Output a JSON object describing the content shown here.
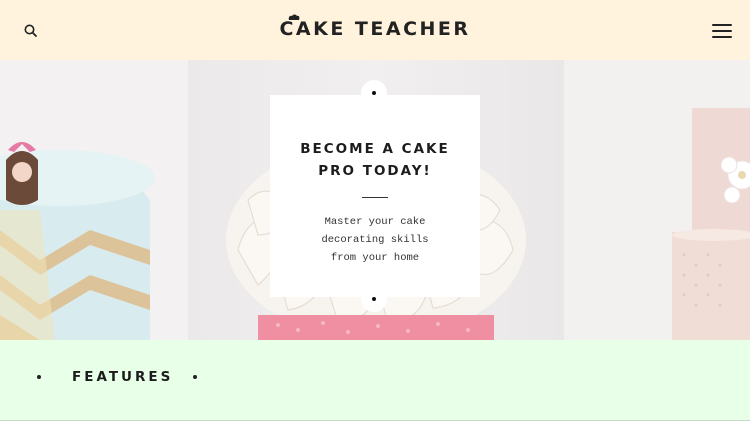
{
  "header": {
    "logo_text": "CAKE TEACHER",
    "search_icon": "search-icon",
    "menu_icon": "hamburger-menu-icon"
  },
  "hero": {
    "title_line1": "BECOME A CAKE",
    "title_line2": "PRO TODAY!",
    "subtitle_line1": "Master your cake",
    "subtitle_line2": "decorating skills",
    "subtitle_line3": "from your home"
  },
  "features": {
    "title": "FEATURES"
  },
  "colors": {
    "header_bg": "#fff3dd",
    "features_bg": "#e8ffe8",
    "text": "#1c1c1c"
  }
}
